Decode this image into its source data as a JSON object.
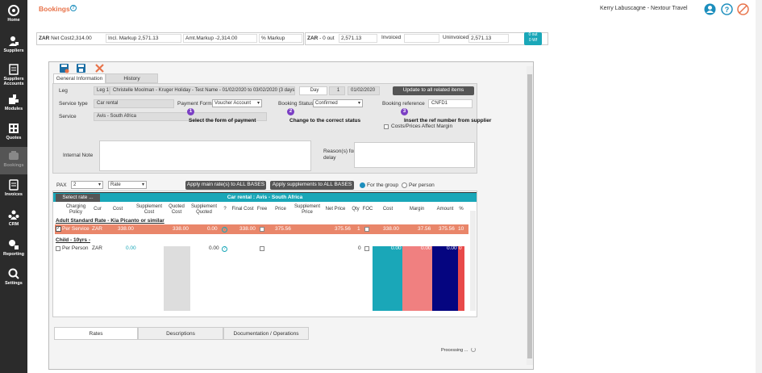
{
  "sidebar": {
    "items": [
      {
        "label": "Home",
        "icon": "home-icon"
      },
      {
        "label": "Suppliers",
        "icon": "suppliers-icon"
      },
      {
        "label": "Suppliers Accounts",
        "icon": "supplier-accounts-icon"
      },
      {
        "label": "Modules",
        "icon": "modules-icon"
      },
      {
        "label": "Quotes",
        "icon": "quotes-icon"
      },
      {
        "label": "Bookings",
        "icon": "bookings-icon"
      },
      {
        "label": "Invoices",
        "icon": "invoices-icon"
      },
      {
        "label": "CRM",
        "icon": "crm-icon"
      },
      {
        "label": "Reporting",
        "icon": "reporting-icon"
      },
      {
        "label": "Settings",
        "icon": "settings-icon"
      }
    ]
  },
  "header": {
    "title": "Bookings",
    "help": "?",
    "user": "Kerry Labuscagne - Nextour Travel"
  },
  "summary": {
    "currency": "ZAR",
    "net_cost_label": "Net Cost",
    "net_cost": "2,314.00",
    "incl_markup_label": "Incl. Markup",
    "incl_markup": "2,571.13",
    "amt_markup_label": "Amt.Markup",
    "amt_markup": "-2,314.00",
    "pct_markup_label": "% Markup",
    "currency2": "ZAR",
    "out_label": "- 0 out",
    "out_value": "2,571.13",
    "invoiced_label": "Invoiced",
    "uninvoiced_label": "Uninvoiced",
    "uninvoiced": "2,571.13",
    "badge_line1": "0 out",
    "badge_line2": "0 Wf"
  },
  "tabs": {
    "general": "General Information",
    "history": "History"
  },
  "form": {
    "leg_label": "Leg",
    "leg_value": "Leg 1",
    "leg_desc": "Christelle Moolman - Kruger Holiday - Test Name - 01/02/2020 to 03/02/2020 (3 days)",
    "day_label": "Day",
    "day_value": "1",
    "date_value": "01/02/2020",
    "update_button": "Update to all related items",
    "service_type_label": "Service type",
    "service_type": "Car rental",
    "payment_form_label": "Payment Form",
    "payment_form": "Voucher Account",
    "booking_status_label": "Booking Status",
    "booking_status": "Confirmed",
    "booking_ref_label": "Booking reference",
    "booking_ref": "CNFD1",
    "service_label": "Service",
    "service": "Avis - South Africa",
    "step1_num": "1",
    "step1": "Select the form of payment",
    "step2_num": "2",
    "step2": "Change to the correct status",
    "step3_num": "3",
    "step3": "Insert the ref number from supplier",
    "costs_checkbox": "Costs/Prices Affect Margin",
    "internal_note_label": "Internal Note",
    "reason_label": "Reason(s) for delay"
  },
  "pax_row": {
    "pax_label": "PAX",
    "pax_value": "2",
    "rate_value": "Rate",
    "apply_main": "Apply main rate(s) to ALL BASES",
    "apply_supp": "Apply supplements to ALL BASES",
    "for_group": "For the group",
    "per_person": "Per person"
  },
  "grid": {
    "select_rate": "Select rate ...",
    "title": "Car rental : Avis - South Africa",
    "headers": [
      "Charging Policy",
      "Cur",
      "Cost",
      "Supplement Cost",
      "Quoted Cost",
      "Supplement Quoted",
      "?",
      "Final Cost",
      "Free",
      "Price",
      "Supplement Price",
      "Net Price",
      "Qty",
      "FOC",
      "Cost",
      "Margin",
      "Amount",
      "%"
    ],
    "section1": "Adult Standard Rate - Kia Picanto or similar",
    "row1": {
      "policy": "Per Service",
      "cur": "ZAR",
      "cost": "338.00",
      "quoted": "338.00",
      "supp_quoted": "0.00",
      "final": "338.00",
      "price": "375.56",
      "net": "375.56",
      "qty": "1",
      "cost2": "338.00",
      "margin": "37.56",
      "amount": "375.56",
      "pct": "10"
    },
    "section2": "Child - 10yrs -",
    "row2": {
      "policy": "Per Person",
      "cur": "ZAR",
      "cost": "0.00",
      "supp_quoted": "0.00",
      "qty": "0",
      "cost2": "0.00",
      "margin": "0.00",
      "amount": "0.00",
      "pct": "0"
    }
  },
  "bottom_tabs": [
    "Rates",
    "Descriptions",
    "Documentation / Operations"
  ],
  "processing": "Processing ...",
  "colors": {
    "accent": "#e8734a",
    "teal": "#1aa7b8",
    "navy": "#050580",
    "pink": "#f08080",
    "purple": "#7b3fc4"
  }
}
